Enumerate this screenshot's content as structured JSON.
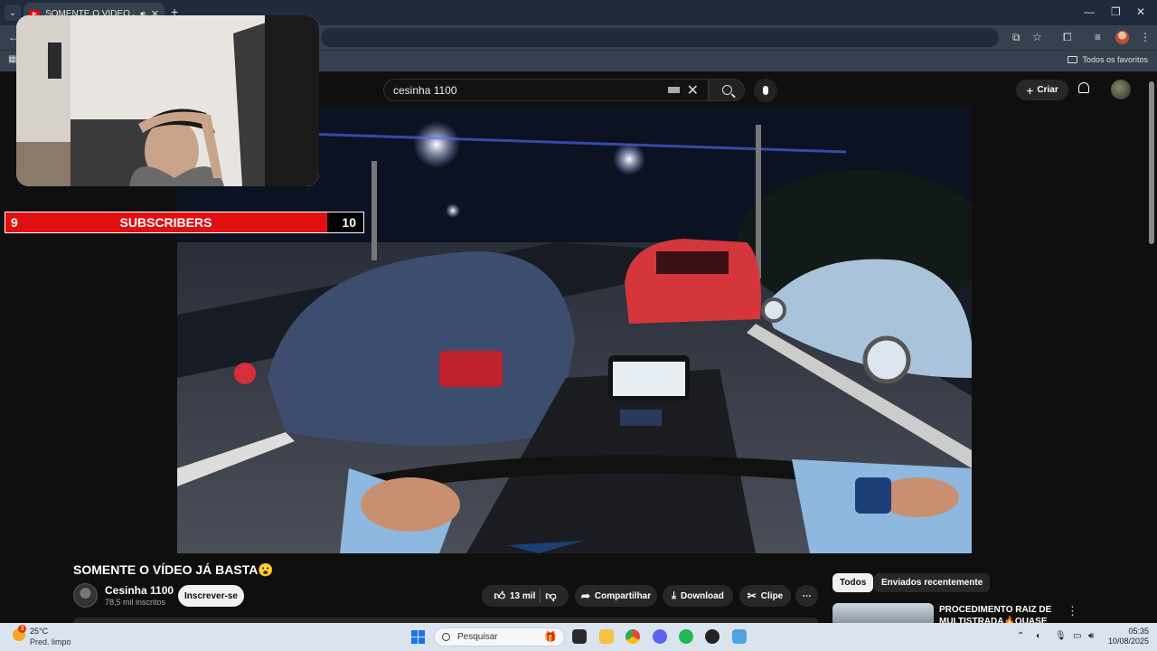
{
  "browser": {
    "tab_title": "SOMENTE O VÍDEO JÁ BASTA",
    "bookmarks_folder": "Todos os favoritos",
    "icons": [
      "youtube-favicon",
      "speaker-icon",
      "close-icon",
      "plus-icon",
      "minimize-icon",
      "maximize-icon",
      "cast-icon",
      "star-icon",
      "extensions-icon",
      "media-icon",
      "menu-icon",
      "folder-icon"
    ]
  },
  "youtube": {
    "search_value": "cesinha 1100",
    "create_label": "Criar"
  },
  "overlay": {
    "subscribers_current": "9",
    "subscribers_label": "SUBSCRIBERS",
    "subscribers_goal": "10",
    "progress_fraction": 0.9,
    "bar_color": "#e01010"
  },
  "video": {
    "title": "SOMENTE O VÍDEO JÁ BASTA😮",
    "channel_name": "Cesinha 1100",
    "channel_subs": "78,5 mil inscritos",
    "subscribe_label": "Inscrever-se",
    "likes": "13 mil",
    "share_label": "Compartilhar",
    "download_label": "Download",
    "clip_label": "Clipe"
  },
  "sidebar": {
    "chips": [
      "Todos",
      "Enviados recentemente"
    ],
    "rec_title": "PROCEDIMENTO RAIZ DE MULTISTRADA🔥QUASE DEU"
  },
  "taskbar": {
    "temperature": "25°C",
    "condition": "Pred. limpo",
    "weather_badge": "3",
    "search_placeholder": "Pesquisar",
    "time": "05:35",
    "date": "10/08/2025"
  }
}
